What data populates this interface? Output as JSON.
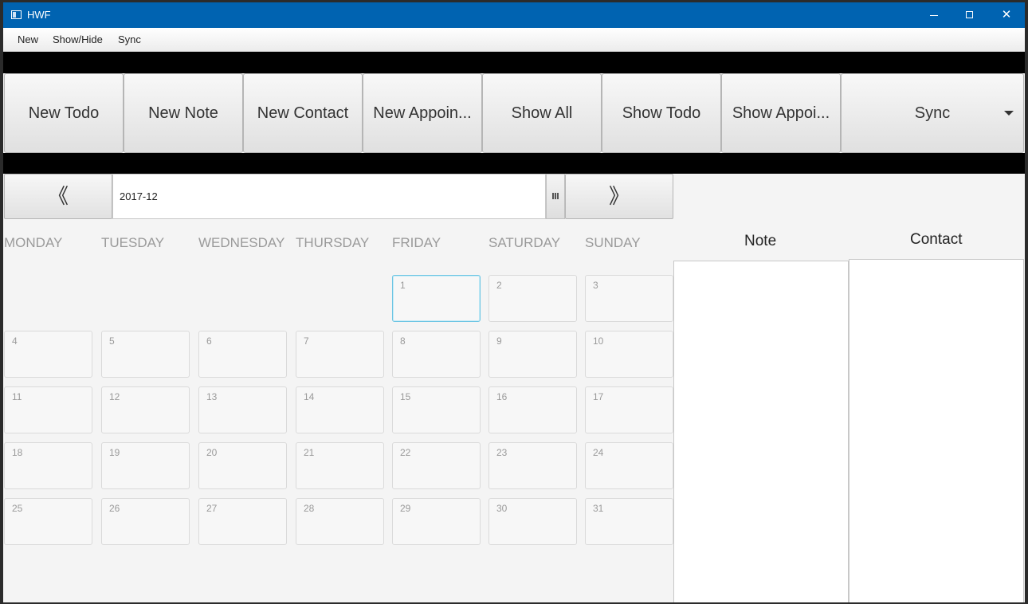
{
  "window": {
    "title": "HWF"
  },
  "menu": [
    {
      "id": "new",
      "label": "New"
    },
    {
      "id": "showhide",
      "label": "Show/Hide"
    },
    {
      "id": "sync",
      "label": "Sync"
    }
  ],
  "toolbar": {
    "new_todo": "New Todo",
    "new_note": "New Note",
    "new_contact": "New Contact",
    "new_appointment": "New Appoin...",
    "show_all": "Show All",
    "show_todo": "Show Todo",
    "show_appointment": "Show Appoi...",
    "sync": "Sync"
  },
  "nav": {
    "prev": "《",
    "next": "》",
    "date_value": "2017-12"
  },
  "weekdays": [
    "MONDAY",
    "TUESDAY",
    "WEDNESDAY",
    "THURSDAY",
    "FRIDAY",
    "SATURDAY",
    "SUNDAY"
  ],
  "calendar": {
    "days": [
      "1",
      "2",
      "3",
      "4",
      "5",
      "6",
      "7",
      "8",
      "9",
      "10",
      "11",
      "12",
      "13",
      "14",
      "15",
      "16",
      "17",
      "18",
      "19",
      "20",
      "21",
      "22",
      "23",
      "24",
      "25",
      "26",
      "27",
      "28",
      "29",
      "30",
      "31"
    ],
    "selected_day": "1"
  },
  "panels": {
    "note_title": "Note",
    "contact_title": "Contact"
  },
  "colors": {
    "titlebar": "#0063b1",
    "selected_border": "#6cc5e3"
  }
}
